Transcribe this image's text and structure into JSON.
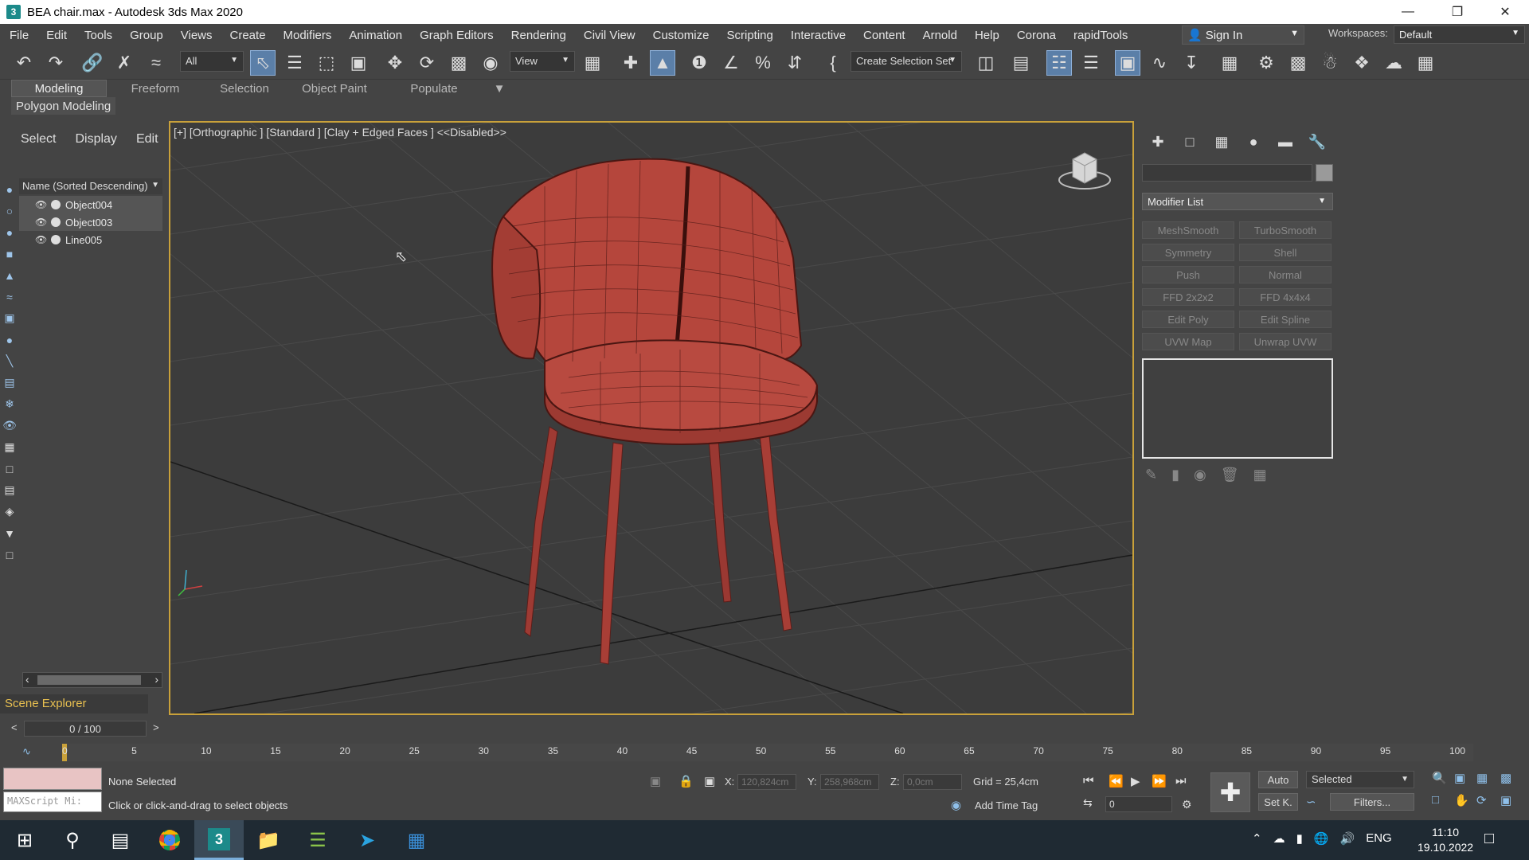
{
  "window": {
    "title": "BEA chair.max - Autodesk 3ds Max 2020",
    "app_icon": "3"
  },
  "menu": [
    "File",
    "Edit",
    "Tools",
    "Group",
    "Views",
    "Create",
    "Modifiers",
    "Animation",
    "Graph Editors",
    "Rendering",
    "Civil View",
    "Customize",
    "Scripting",
    "Interactive",
    "Content",
    "Arnold",
    "Help",
    "Corona",
    "rapidTools"
  ],
  "signin": "Sign In",
  "workspaces": {
    "label": "Workspaces:",
    "value": "Default"
  },
  "toolbar": {
    "filter": "All",
    "refcoord": "View",
    "selset": "Create Selection Set"
  },
  "ribbon": {
    "tabs": [
      "Modeling",
      "Freeform",
      "Selection",
      "Object Paint",
      "Populate"
    ],
    "active": "Modeling",
    "sub": "Polygon Modeling"
  },
  "scene": {
    "tabs": [
      "Select",
      "Display",
      "Edit"
    ],
    "header": "Name (Sorted Descending)",
    "objects": [
      "Object004",
      "Object003",
      "Line005"
    ],
    "label": "Scene Explorer"
  },
  "viewport": {
    "label": "[+] [Orthographic ] [Standard ] [Clay + Edged Faces ] <<Disabled>>"
  },
  "command_panel": {
    "modifier_list": "Modifier List",
    "buttons": [
      "MeshSmooth",
      "TurboSmooth",
      "Symmetry",
      "Shell",
      "Push",
      "Normal",
      "FFD 2x2x2",
      "FFD 4x4x4",
      "Edit Poly",
      "Edit Spline",
      "UVW Map",
      "Unwrap UVW"
    ]
  },
  "timeline": {
    "slider": "0 / 100",
    "ticks": [
      "0",
      "5",
      "10",
      "15",
      "20",
      "25",
      "30",
      "35",
      "40",
      "45",
      "50",
      "55",
      "60",
      "65",
      "70",
      "75",
      "80",
      "85",
      "90",
      "95",
      "100"
    ]
  },
  "status": {
    "maxscript": "MAXScript Mi:",
    "selection": "None Selected",
    "prompt": "Click or click-and-drag to select objects",
    "x_label": "X:",
    "x": "120,824cm",
    "y_label": "Y:",
    "y": "258,968cm",
    "z_label": "Z:",
    "z": "0,0cm",
    "grid": "Grid = 25,4cm",
    "add_time_tag": "Add Time Tag",
    "frame": "0",
    "auto": "Auto",
    "setk": "Set K.",
    "selected": "Selected",
    "filters": "Filters..."
  },
  "taskbar": {
    "lang": "ENG",
    "time": "11:10",
    "date": "19.10.2022"
  },
  "colors": {
    "accent": "#5b7fa8",
    "viewport_border": "#c9a13a",
    "chair": "#b5463c"
  }
}
